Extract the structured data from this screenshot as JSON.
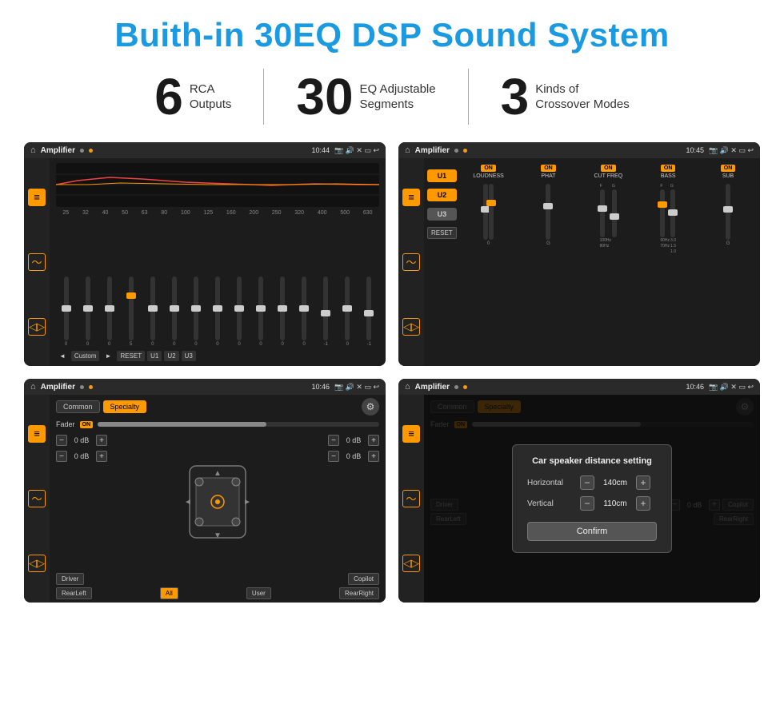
{
  "title": "Buith-in 30EQ DSP Sound System",
  "stats": [
    {
      "number": "6",
      "label": "RCA\nOutputs"
    },
    {
      "number": "30",
      "label": "EQ Adjustable\nSegments"
    },
    {
      "number": "3",
      "label": "Kinds of\nCrossover Modes"
    }
  ],
  "screens": [
    {
      "id": "screen1",
      "status_bar": {
        "title": "Amplifier",
        "time": "10:44"
      },
      "type": "eq",
      "eq_frequencies": [
        "25",
        "32",
        "40",
        "50",
        "63",
        "80",
        "100",
        "125",
        "160",
        "200",
        "250",
        "320",
        "400",
        "500",
        "630"
      ],
      "eq_values": [
        "0",
        "0",
        "0",
        "5",
        "0",
        "0",
        "0",
        "0",
        "0",
        "0",
        "0",
        "0",
        "-1",
        "0",
        "-1"
      ],
      "eq_preset": "Custom",
      "eq_buttons": [
        "RESET",
        "U1",
        "U2",
        "U3"
      ]
    },
    {
      "id": "screen2",
      "status_bar": {
        "title": "Amplifier",
        "time": "10:45"
      },
      "type": "crossover",
      "u_selections": [
        "U1",
        "U2",
        "U3"
      ],
      "crossover_cols": [
        {
          "label": "LOUDNESS",
          "on": true
        },
        {
          "label": "PHAT",
          "on": true
        },
        {
          "label": "CUT FREQ",
          "on": true
        },
        {
          "label": "BASS",
          "on": true
        },
        {
          "label": "SUB",
          "on": true
        }
      ],
      "reset_label": "RESET"
    },
    {
      "id": "screen3",
      "status_bar": {
        "title": "Amplifier",
        "time": "10:46"
      },
      "type": "fader",
      "tabs": [
        "Common",
        "Specialty"
      ],
      "active_tab": "Specialty",
      "fader_label": "Fader",
      "fader_on": "ON",
      "vol_rows": [
        {
          "value": "0 dB"
        },
        {
          "value": "0 dB"
        },
        {
          "value": "0 dB"
        },
        {
          "value": "0 dB"
        }
      ],
      "bottom_buttons": [
        "Driver",
        "",
        "Copilot",
        "RearLeft",
        "All",
        "User",
        "RearRight"
      ]
    },
    {
      "id": "screen4",
      "status_bar": {
        "title": "Amplifier",
        "time": "10:46"
      },
      "type": "dialog",
      "tabs": [
        "Common",
        "Specialty"
      ],
      "active_tab": "Specialty",
      "dialog": {
        "title": "Car speaker distance setting",
        "rows": [
          {
            "label": "Horizontal",
            "value": "140cm"
          },
          {
            "label": "Vertical",
            "value": "110cm"
          }
        ],
        "confirm_label": "Confirm"
      }
    }
  ]
}
